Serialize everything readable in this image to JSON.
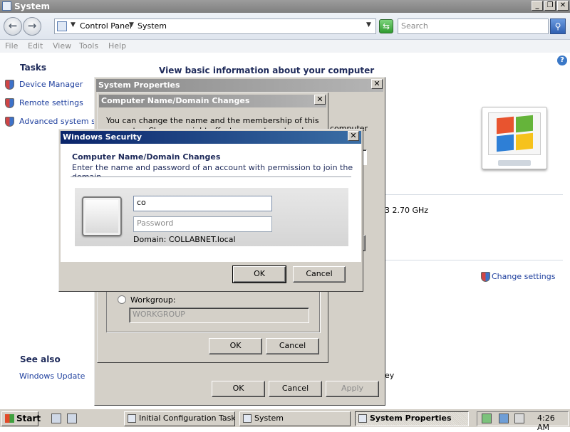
{
  "window": {
    "title": "System"
  },
  "caption_buttons": {
    "minimize": "_",
    "restore": "❐",
    "close": "✕"
  },
  "address": {
    "crumbs": [
      "Control Panel",
      "System"
    ],
    "search_placeholder": "Search"
  },
  "menu": [
    "File",
    "Edit",
    "View",
    "Tools",
    "Help"
  ],
  "help_glyph": "?",
  "main": {
    "heading": "View basic information about your computer",
    "cpu_speed_partial": "3   2.70 GHz",
    "change_settings": "Change settings",
    "ey_fragment": "ey"
  },
  "tasks": {
    "title": "Tasks",
    "items": [
      "Device Manager",
      "Remote settings",
      "Advanced system settings"
    ]
  },
  "see_also": {
    "title": "See also",
    "items": [
      "Windows Update"
    ]
  },
  "system_properties": {
    "title": "System Properties",
    "ok": "OK",
    "cancel": "Cancel",
    "apply": "Apply"
  },
  "domain_changes": {
    "title": "Computer Name/Domain Changes",
    "line1": "You can change the name and the membership of this",
    "line2": "computer. Changes might affect access to network resources",
    "computer_fragment": "computer",
    "workgroup_label": "Workgroup:",
    "workgroup_value": "WORKGROUP",
    "ok": "OK",
    "cancel": "Cancel"
  },
  "windows_security": {
    "title": "Windows Security",
    "heading": "Computer Name/Domain Changes",
    "subtitle": "Enter the name and password of an account with permission to join the domain.",
    "username_value": "co",
    "password_placeholder": "Password",
    "domain_label": "Domain: COLLABNET.local",
    "ok": "OK",
    "cancel": "Cancel"
  },
  "taskbar": {
    "start": "Start",
    "items": [
      "Initial Configuration Tasks",
      "System",
      "System Properties"
    ],
    "clock": "4:26 AM"
  },
  "colors": {
    "link": "#1e3f9e",
    "active_title": "#0a246a",
    "inactive_title": "#8a8a8a",
    "dialog_face": "#d4d0c8"
  }
}
